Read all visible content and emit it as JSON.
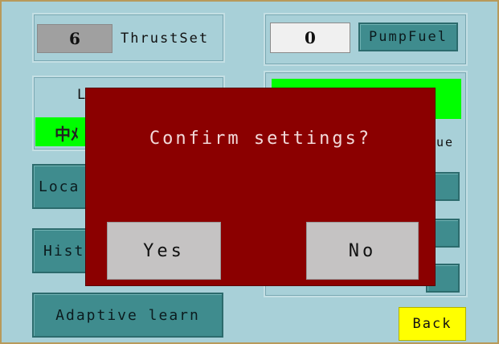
{
  "thrust": {
    "value": "6",
    "label": "ThrustSet"
  },
  "pump": {
    "value": "0",
    "label": "PumpFuel"
  },
  "left_panel": {
    "partial_label": "L",
    "green_text_partial": "中ﾒ"
  },
  "right_panel": {
    "partial_label": "lue"
  },
  "left_buttons": [
    {
      "label": "Loca"
    },
    {
      "label": "Hist"
    },
    {
      "label": "Adaptive learn"
    }
  ],
  "dialog": {
    "title": "Confirm settings?",
    "yes": "Yes",
    "no": "No"
  },
  "back": {
    "label": "Back"
  },
  "colors": {
    "background": "#a8d0d8",
    "dialog": "#8b0000",
    "teal_button": "#3f8c8e",
    "green": "#00ff00",
    "back_button": "#ffff00"
  }
}
